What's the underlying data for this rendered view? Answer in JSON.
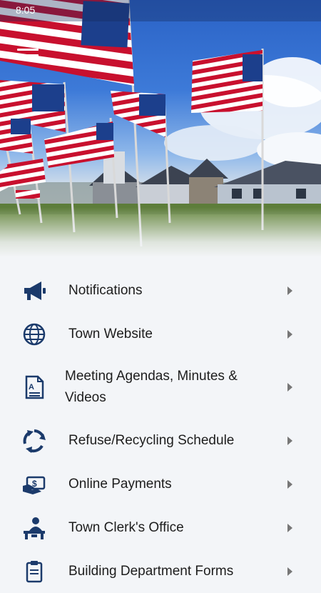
{
  "status_bar": {
    "time": "8:05"
  },
  "header": {
    "menu_icon": "hamburger-menu-icon"
  },
  "menu": {
    "items": [
      {
        "label": "Notifications",
        "icon": "megaphone-icon"
      },
      {
        "label": "Town Website",
        "icon": "globe-icon"
      },
      {
        "label": "Meeting Agendas, Minutes & Videos",
        "icon": "document-icon"
      },
      {
        "label": "Refuse/Recycling Schedule",
        "icon": "recycle-icon"
      },
      {
        "label": "Online Payments",
        "icon": "payment-icon"
      },
      {
        "label": "Town Clerk's Office",
        "icon": "clerk-desk-icon"
      },
      {
        "label": "Building Department Forms",
        "icon": "clipboard-icon"
      }
    ]
  },
  "colors": {
    "icon_navy": "#1b3a6b",
    "background": "#f3f5f8"
  }
}
